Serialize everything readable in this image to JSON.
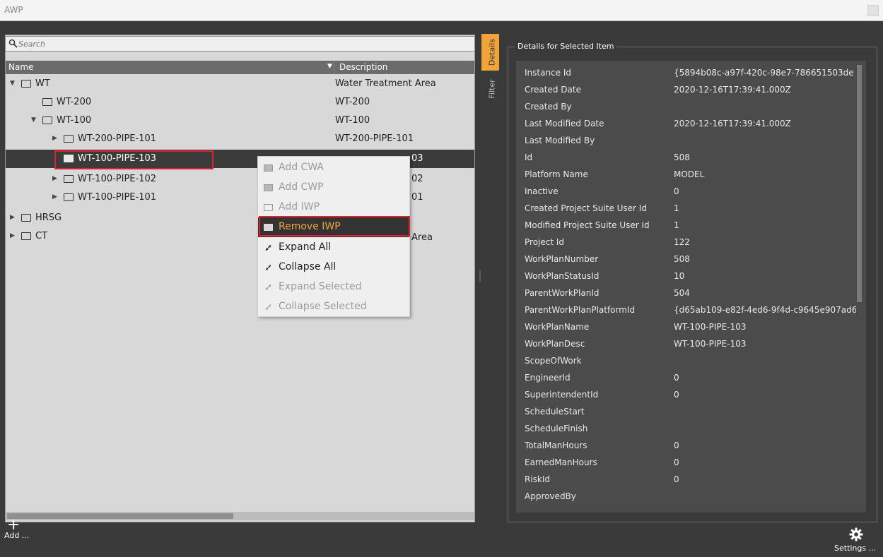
{
  "window": {
    "title": "AWP"
  },
  "search": {
    "placeholder": "Search"
  },
  "tree": {
    "header_name": "Name",
    "header_description": "Description",
    "rows": [
      {
        "name": "WT",
        "description": "Water Treatment Area"
      },
      {
        "name": "WT-200",
        "description": "WT-200"
      },
      {
        "name": "WT-100",
        "description": "WT-100"
      },
      {
        "name": "WT-200-PIPE-101",
        "description": "WT-200-PIPE-101"
      },
      {
        "name": "WT-100-PIPE-103",
        "description": "03"
      },
      {
        "name": "WT-100-PIPE-102",
        "description": "02"
      },
      {
        "name": "WT-100-PIPE-101",
        "description": "01"
      },
      {
        "name": "HRSG",
        "description": ""
      },
      {
        "name": "CT",
        "description": "Area"
      }
    ]
  },
  "context_menu": {
    "items": [
      {
        "label": "Add CWA",
        "state": "disabled"
      },
      {
        "label": "Add CWP",
        "state": "disabled"
      },
      {
        "label": "Add IWP",
        "state": "disabled"
      },
      {
        "label": "Remove IWP",
        "state": "highlighted"
      },
      {
        "label": "Expand All",
        "state": "enabled"
      },
      {
        "label": "Collapse All",
        "state": "enabled"
      },
      {
        "label": "Expand Selected",
        "state": "disabled"
      },
      {
        "label": "Collapse Selected",
        "state": "disabled"
      }
    ]
  },
  "side_tabs": {
    "details": "Details",
    "filter": "Filter"
  },
  "details": {
    "title": "Details for Selected Item",
    "properties": [
      {
        "key": "Instance Id",
        "value": "{5894b08c-a97f-420c-98e7-786651503de"
      },
      {
        "key": "Created Date",
        "value": "2020-12-16T17:39:41.000Z"
      },
      {
        "key": "Created By",
        "value": ""
      },
      {
        "key": "Last Modified Date",
        "value": "2020-12-16T17:39:41.000Z"
      },
      {
        "key": "Last Modified By",
        "value": ""
      },
      {
        "key": "Id",
        "value": "508"
      },
      {
        "key": "Platform Name",
        "value": "MODEL"
      },
      {
        "key": "Inactive",
        "value": "0"
      },
      {
        "key": "Created Project Suite User Id",
        "value": "1"
      },
      {
        "key": "Modified Project Suite User Id",
        "value": "1"
      },
      {
        "key": "Project Id",
        "value": "122"
      },
      {
        "key": "WorkPlanNumber",
        "value": "508"
      },
      {
        "key": "WorkPlanStatusId",
        "value": "10"
      },
      {
        "key": "ParentWorkPlanId",
        "value": "504"
      },
      {
        "key": "ParentWorkPlanPlatformId",
        "value": "{d65ab109-e82f-4ed6-9f4d-c9645e907ad6"
      },
      {
        "key": "WorkPlanName",
        "value": "WT-100-PIPE-103"
      },
      {
        "key": "WorkPlanDesc",
        "value": "WT-100-PIPE-103"
      },
      {
        "key": "ScopeOfWork",
        "value": ""
      },
      {
        "key": "EngineerId",
        "value": "0"
      },
      {
        "key": "SuperintendentId",
        "value": "0"
      },
      {
        "key": "ScheduleStart",
        "value": ""
      },
      {
        "key": "ScheduleFinish",
        "value": ""
      },
      {
        "key": "TotalManHours",
        "value": "0"
      },
      {
        "key": "EarnedManHours",
        "value": "0"
      },
      {
        "key": "RiskId",
        "value": "0"
      },
      {
        "key": "ApprovedBy",
        "value": ""
      }
    ]
  },
  "bottom": {
    "add_label": "Add ...",
    "settings_label": "Settings ..."
  },
  "colors": {
    "accent": "#f0a43a",
    "highlight_border": "#d9232e",
    "selected_row": "#3b3b3b"
  }
}
